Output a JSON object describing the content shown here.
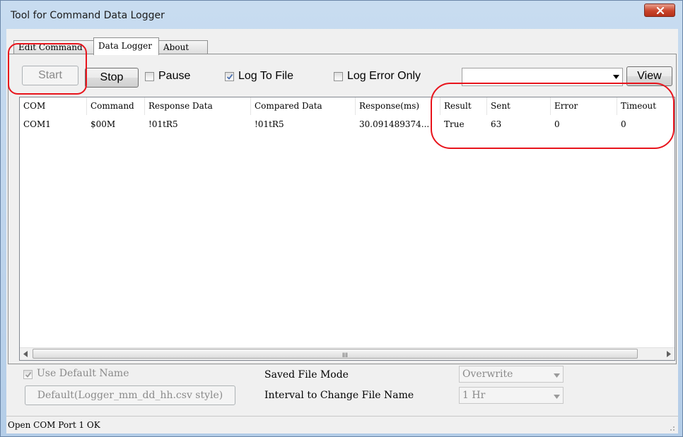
{
  "window": {
    "title": "Tool for Command Data Logger"
  },
  "tabs": [
    {
      "label": "Edit Command"
    },
    {
      "label": "Data Logger"
    },
    {
      "label": "About"
    }
  ],
  "toolbar": {
    "start_label": "Start",
    "stop_label": "Stop",
    "pause_label": "Pause",
    "log_to_file_label": "Log To File",
    "log_error_only_label": "Log Error Only",
    "view_label": "View",
    "log_select_value": "",
    "log_to_file_checked": true,
    "pause_checked": false,
    "log_error_only_checked": false
  },
  "table": {
    "columns": [
      "COM",
      "Command",
      "Response Data",
      "Compared Data",
      "Response(ms)",
      "Result",
      "Sent",
      "Error",
      "Timeout"
    ],
    "rows": [
      [
        "COM1",
        "$00M",
        "!01tR5",
        "!01tR5",
        "30.091489374...",
        "True",
        "63",
        "0",
        "0"
      ]
    ],
    "scroll_grip": "III"
  },
  "file": {
    "use_default_name_label": "Use Default Name",
    "use_default_name_checked": true,
    "default_name_button": "Default(Logger_mm_dd_hh.csv style)",
    "saved_file_mode_label": "Saved File Mode",
    "saved_file_mode_value": "Overwrite",
    "interval_label": "Interval to Change File Name",
    "interval_value": "1 Hr"
  },
  "status": {
    "text": "Open COM Port 1 OK"
  },
  "colors": {
    "annotation": "#e8141c",
    "accent_check": "#4a6fb0"
  }
}
